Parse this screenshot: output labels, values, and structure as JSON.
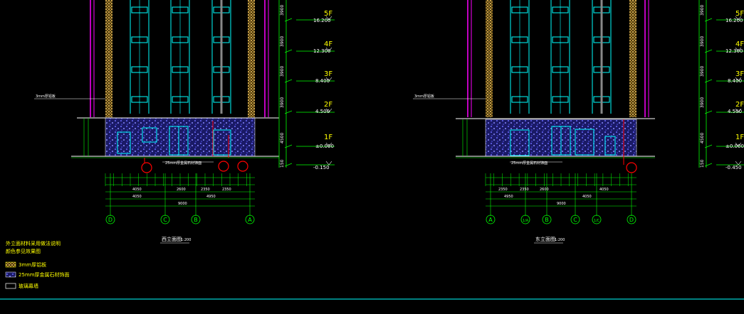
{
  "colors": {
    "background": "#000000",
    "grid_green": "#00ff00",
    "window_cyan": "#00ffff",
    "structure_magenta": "#ff00ff",
    "marker_red": "#ff0000",
    "floor_yellow": "#ffff00",
    "stone_blue": "#3b3bd0",
    "white": "#ffffff"
  },
  "left_elevation": {
    "title": "西立面图",
    "scale": "1:200",
    "callout_top": "3mm厚铝板",
    "callout_bottom": "25mm厚金属石材饰面",
    "floors": [
      {
        "label": "5F",
        "elev": "16.200"
      },
      {
        "label": "4F",
        "elev": "12.300"
      },
      {
        "label": "3F",
        "elev": "8.400"
      },
      {
        "label": "2F",
        "elev": "4.500"
      },
      {
        "label": "1F",
        "elev": "±0.000"
      }
    ],
    "bottom_elev": "-0.150",
    "storey_dims": [
      "3900",
      "3900",
      "3900",
      "3900",
      "4500"
    ],
    "base_dim": "150",
    "axes": [
      "D",
      "C",
      "B",
      "A"
    ],
    "dim_row2": [
      "4050",
      "2600",
      "2350",
      "2350"
    ],
    "dim_row3": [
      "4050",
      "4950"
    ],
    "dim_total": "9000"
  },
  "right_elevation": {
    "title": "东立面图",
    "scale": "1:200",
    "callout_top": "3mm厚铝板",
    "callout_bottom": "25mm厚金属石材饰面",
    "floors": [
      {
        "label": "5F",
        "elev": "16.200"
      },
      {
        "label": "4F",
        "elev": "12.300"
      },
      {
        "label": "3F",
        "elev": "8.400"
      },
      {
        "label": "2F",
        "elev": "4.500"
      },
      {
        "label": "1F",
        "elev": "±0.000"
      }
    ],
    "bottom_elev": "-0.450",
    "storey_dims": [
      "3900",
      "3900",
      "3900",
      "3900",
      "4500"
    ],
    "base_dim": "150",
    "axes": [
      "A",
      "1/A",
      "B",
      "C",
      "1/C",
      "D"
    ],
    "dim_row2": [
      "2350",
      "2350",
      "2600",
      "4050"
    ],
    "dim_row3": [
      "4950",
      "4050"
    ],
    "dim_total": "9000"
  },
  "legend": {
    "heading_line1": "外立面材料采用做法说明",
    "heading_line2": "颜色参见效果图",
    "items": [
      {
        "label": "3mm厚铝板"
      },
      {
        "label": "25mm厚金属石材饰面"
      },
      {
        "label": "玻璃幕墙"
      }
    ]
  }
}
